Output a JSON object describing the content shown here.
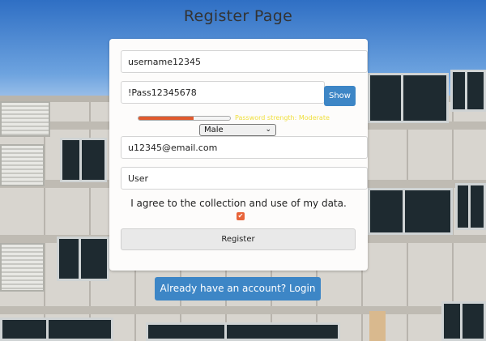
{
  "page": {
    "title": "Register Page"
  },
  "form": {
    "username": {
      "value": "username12345"
    },
    "password": {
      "value": "!Pass12345678",
      "show_label": "Show"
    },
    "strength": {
      "level": 0.6,
      "text": "Password strength: Moderate"
    },
    "gender": {
      "selected": "Male"
    },
    "email": {
      "value": "u12345@email.com"
    },
    "role": {
      "value": "User"
    },
    "consent": {
      "text": "I agree to the collection and use of my data.",
      "checked": true
    },
    "register_label": "Register"
  },
  "login_link": {
    "label": "Already have an account? Login"
  },
  "colors": {
    "accent": "#3d86c6",
    "strength": "#e05a2e",
    "checkbox": "#e8643a"
  }
}
